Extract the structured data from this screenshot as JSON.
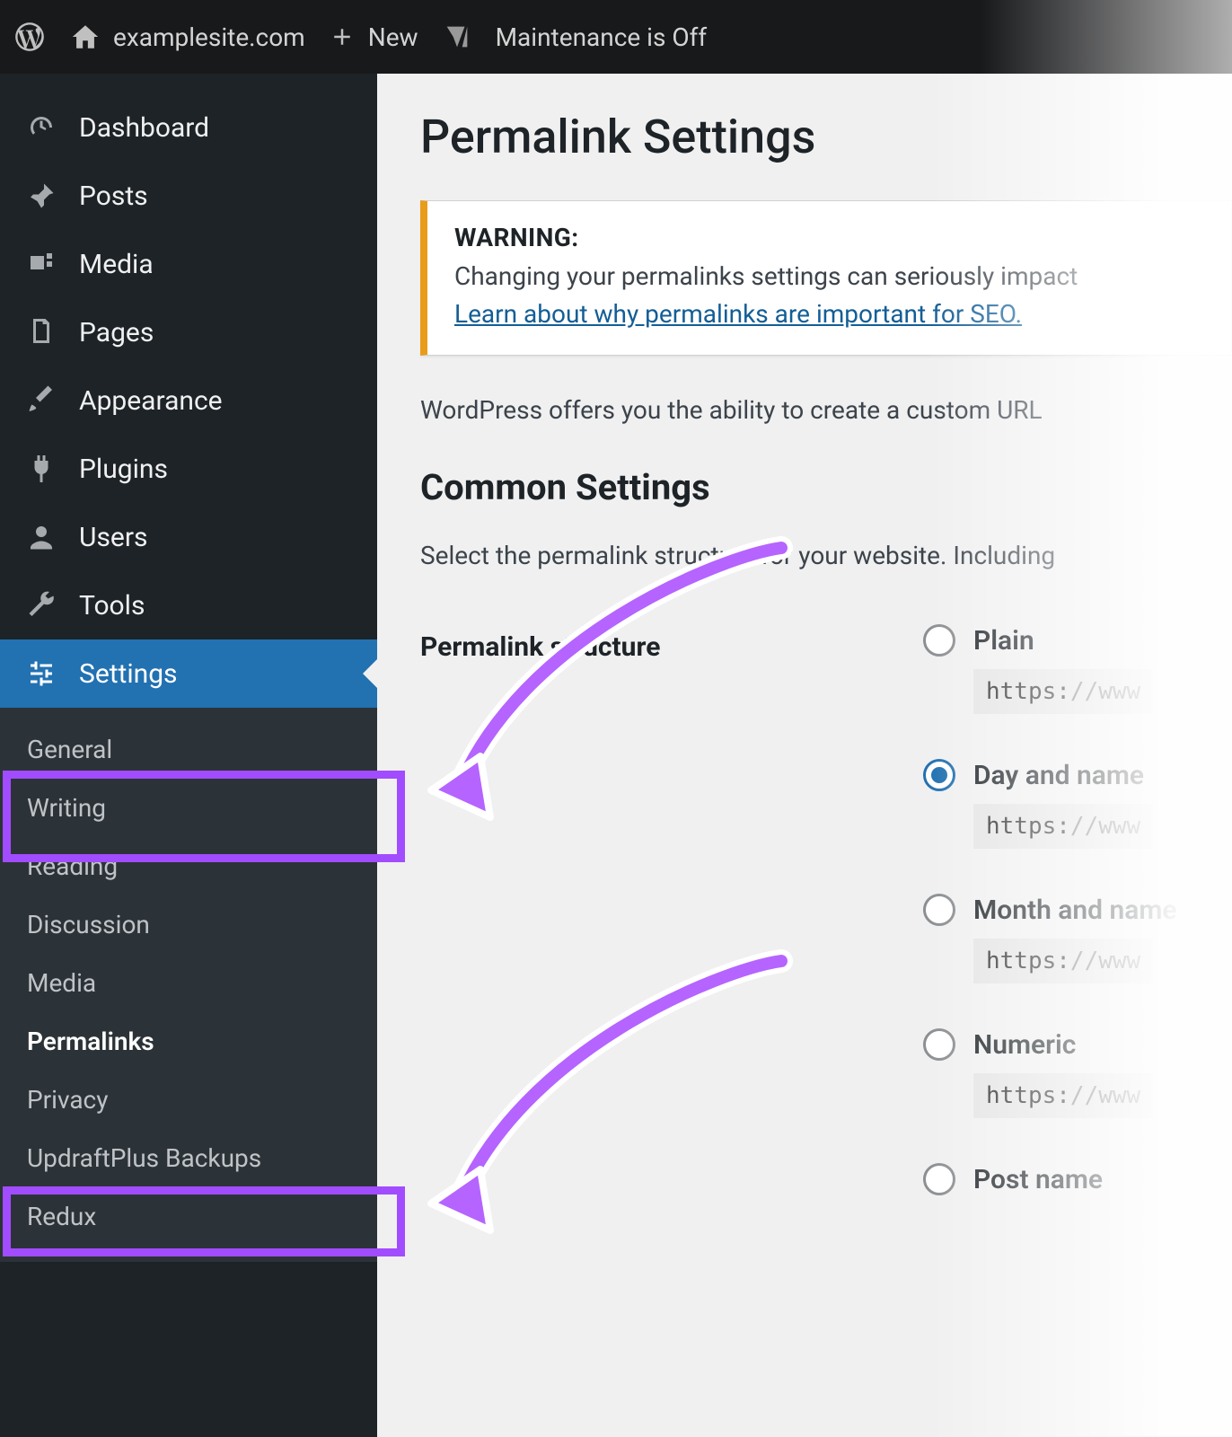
{
  "topbar": {
    "site_name": "examplesite.com",
    "new_label": "New",
    "maintenance_label": "Maintenance is Off"
  },
  "sidebar": {
    "items": [
      {
        "label": "Dashboard",
        "icon": "dashboard"
      },
      {
        "label": "Posts",
        "icon": "pin"
      },
      {
        "label": "Media",
        "icon": "media"
      },
      {
        "label": "Pages",
        "icon": "pages"
      },
      {
        "label": "Appearance",
        "icon": "brush"
      },
      {
        "label": "Plugins",
        "icon": "plug"
      },
      {
        "label": "Users",
        "icon": "user"
      },
      {
        "label": "Tools",
        "icon": "wrench"
      },
      {
        "label": "Settings",
        "icon": "sliders"
      }
    ],
    "submenu": [
      "General",
      "Writing",
      "Reading",
      "Discussion",
      "Media",
      "Permalinks",
      "Privacy",
      "UpdraftPlus Backups",
      "Redux"
    ],
    "submenu_current": "Permalinks",
    "active": "Settings"
  },
  "page": {
    "title": "Permalink Settings",
    "warning_heading": "WARNING:",
    "warning_body": "Changing your permalinks settings can seriously impact",
    "warning_link": "Learn about why permalinks are important for SEO.",
    "intro": "WordPress offers you the ability to create a custom URL",
    "section_heading": "Common Settings",
    "help_text": "Select the permalink structure for your website. Including",
    "structure_label": "Permalink structure",
    "options": [
      {
        "name": "Plain",
        "url_prefix": "https:",
        "url_rest": "//www",
        "checked": false
      },
      {
        "name": "Day and name",
        "url_prefix": "https:",
        "url_rest": "//www",
        "checked": true
      },
      {
        "name": "Month and name",
        "url_prefix": "https:",
        "url_rest": "//www",
        "checked": false
      },
      {
        "name": "Numeric",
        "url_prefix": "https:",
        "url_rest": "//www",
        "checked": false
      },
      {
        "name": "Post name",
        "url_prefix": "",
        "url_rest": "",
        "checked": false
      }
    ]
  }
}
